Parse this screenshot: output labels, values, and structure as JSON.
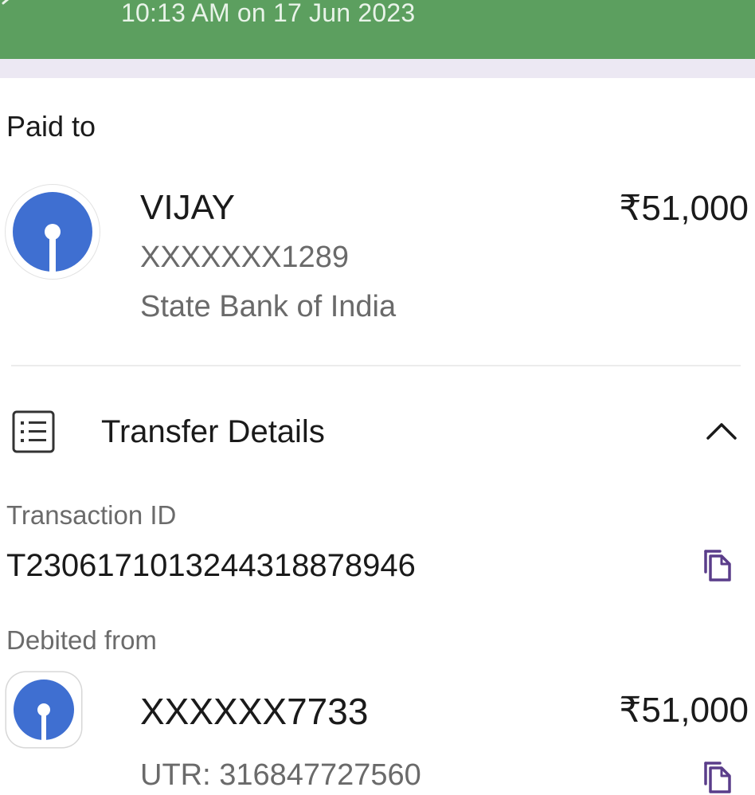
{
  "header": {
    "timestamp": "10:13 AM on 17 Jun 2023",
    "background_color": "#5c9f5f"
  },
  "paid_to": {
    "section_label": "Paid to",
    "name": "VIJAY",
    "account": "XXXXXXX1289",
    "bank": "State Bank of India",
    "amount": "₹51,000",
    "logo_icon": "sbi-logo-icon"
  },
  "transfer_details": {
    "title": "Transfer Details",
    "icon": "list-details-icon",
    "toggle_icon": "chevron-up-icon",
    "transaction_id_label": "Transaction ID",
    "transaction_id": "T2306171013244318878946",
    "debited_from_label": "Debited from",
    "debit_account": "XXXXXX7733",
    "debit_amount": "₹51,000",
    "utr": "UTR: 316847727560",
    "copy_icon": "copy-icon"
  },
  "colors": {
    "accent_purple": "#5a3d8a",
    "sbi_blue": "#3f6fd1"
  }
}
